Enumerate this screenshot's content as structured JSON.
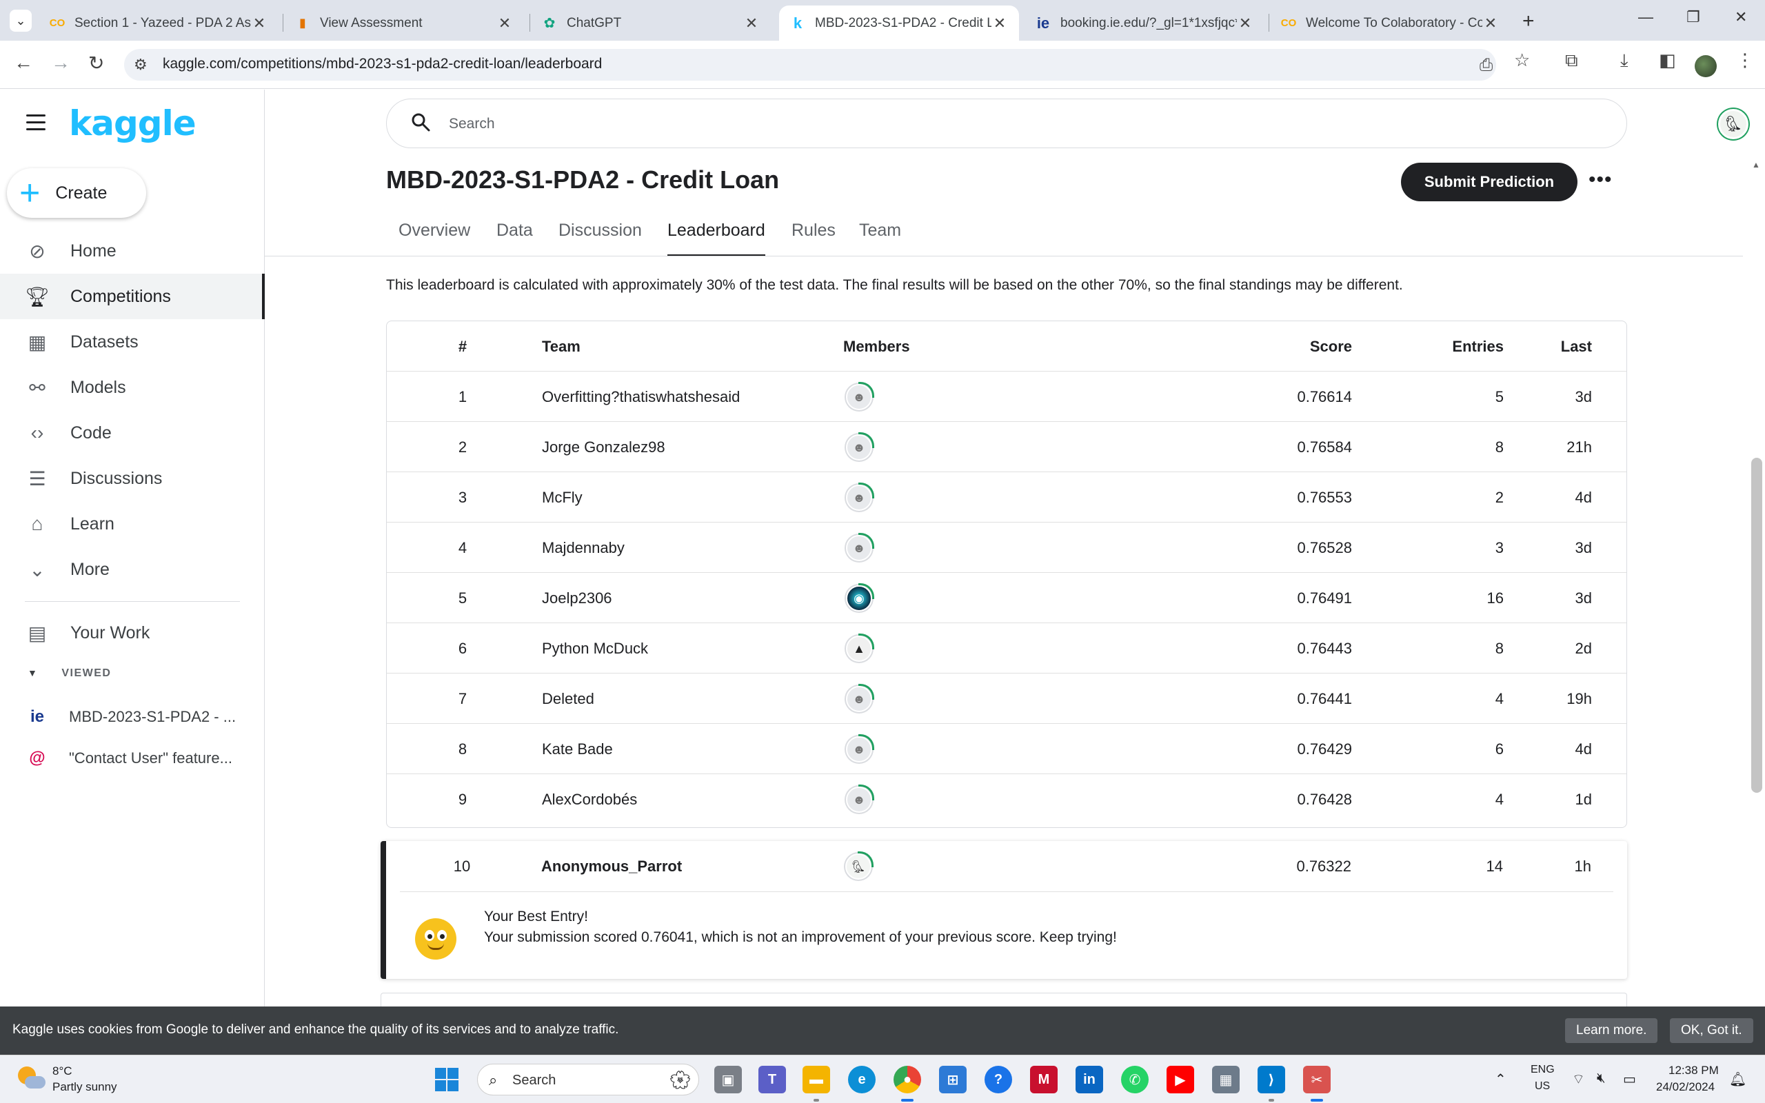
{
  "browser": {
    "tabs": [
      {
        "title": "Section 1 - Yazeed - PDA 2 Assi",
        "favicon": "colab-icon",
        "fav_color": "#f9ab00"
      },
      {
        "title": "View Assessment",
        "favicon": "chart-icon",
        "fav_color": "#e37400"
      },
      {
        "title": "ChatGPT",
        "favicon": "chatgpt-icon",
        "fav_color": "#10a37f"
      },
      {
        "title": "MBD-2023-S1-PDA2 - Credit Lo",
        "favicon": "kaggle-icon",
        "fav_color": "#20beff"
      },
      {
        "title": "booking.ie.edu/?_gl=1*1xsfjqc*",
        "favicon": "ie-icon",
        "fav_color": "#1a3a8f"
      },
      {
        "title": "Welcome To Colaboratory - Col",
        "favicon": "colab-icon",
        "fav_color": "#f9ab00"
      }
    ],
    "active_tab": 3,
    "url": "kaggle.com/competitions/mbd-2023-s1-pda2-credit-loan/leaderboard"
  },
  "sidebar": {
    "logo": "kaggle",
    "create_label": "Create",
    "items": [
      {
        "label": "Home",
        "icon": "compass-icon"
      },
      {
        "label": "Competitions",
        "icon": "trophy-icon"
      },
      {
        "label": "Datasets",
        "icon": "table-icon"
      },
      {
        "label": "Models",
        "icon": "models-icon"
      },
      {
        "label": "Code",
        "icon": "code-icon"
      },
      {
        "label": "Discussions",
        "icon": "discussions-icon"
      },
      {
        "label": "Learn",
        "icon": "learn-icon"
      },
      {
        "label": "More",
        "icon": "chevron-down-icon"
      }
    ],
    "your_work": "Your Work",
    "viewed_header": "VIEWED",
    "viewed": [
      {
        "label": "MBD-2023-S1-PDA2 - ...",
        "icon": "ie-icon"
      },
      {
        "label": "\"Contact User\" feature...",
        "icon": "debian-icon"
      }
    ]
  },
  "search": {
    "placeholder": "Search"
  },
  "competition": {
    "title": "MBD-2023-S1-PDA2 - Credit Loan",
    "submit_label": "Submit Prediction",
    "more_label": "•••",
    "tabs": [
      "Overview",
      "Data",
      "Discussion",
      "Leaderboard",
      "Rules",
      "Team"
    ],
    "active_tab": "Leaderboard",
    "note": "This leaderboard is calculated with approximately 30% of the test data. The final results will be based on the other 70%, so the final standings may be different."
  },
  "leaderboard": {
    "headers": {
      "rank": "#",
      "team": "Team",
      "members": "Members",
      "score": "Score",
      "entries": "Entries",
      "last": "Last"
    },
    "rows": [
      {
        "rank": "1",
        "team": "Overfitting?thatiswhatshesaid",
        "score": "0.76614",
        "entries": "5",
        "last": "3d",
        "avatar": "default"
      },
      {
        "rank": "2",
        "team": "Jorge Gonzalez98",
        "score": "0.76584",
        "entries": "8",
        "last": "21h",
        "avatar": "default"
      },
      {
        "rank": "3",
        "team": "McFly",
        "score": "0.76553",
        "entries": "2",
        "last": "4d",
        "avatar": "default"
      },
      {
        "rank": "4",
        "team": "Majdennaby",
        "score": "0.76528",
        "entries": "3",
        "last": "3d",
        "avatar": "default"
      },
      {
        "rank": "5",
        "team": "Joelp2306",
        "score": "0.76491",
        "entries": "16",
        "last": "3d",
        "avatar": "teal"
      },
      {
        "rank": "6",
        "team": "Python McDuck",
        "score": "0.76443",
        "entries": "8",
        "last": "2d",
        "avatar": "duck"
      },
      {
        "rank": "7",
        "team": "Deleted",
        "score": "0.76441",
        "entries": "4",
        "last": "19h",
        "avatar": "default"
      },
      {
        "rank": "8",
        "team": "Kate Bade",
        "score": "0.76429",
        "entries": "6",
        "last": "4d",
        "avatar": "default"
      },
      {
        "rank": "9",
        "team": "AlexCordobés",
        "score": "0.76428",
        "entries": "4",
        "last": "1d",
        "avatar": "default"
      }
    ],
    "my_row": {
      "rank": "10",
      "team": "Anonymous_Parrot",
      "score": "0.76322",
      "entries": "14",
      "last": "1h"
    },
    "best_entry_title": "Your Best Entry!",
    "best_entry_msg": "Your submission scored 0.76041, which is not an improvement of your previous score. Keep trying!"
  },
  "cookie": {
    "text": "Kaggle uses cookies from Google to deliver and enhance the quality of its services and to analyze traffic.",
    "learn_more": "Learn more.",
    "ok": "OK, Got it."
  },
  "taskbar": {
    "temp": "8°C",
    "weather": "Partly sunny",
    "search_label": "Search",
    "lang_top": "ENG",
    "lang_bottom": "US",
    "time": "12:38 PM",
    "date": "24/02/2024"
  },
  "colors": {
    "kaggle_blue": "#20beff",
    "dark": "#202124",
    "progress_green": "#20a060"
  }
}
